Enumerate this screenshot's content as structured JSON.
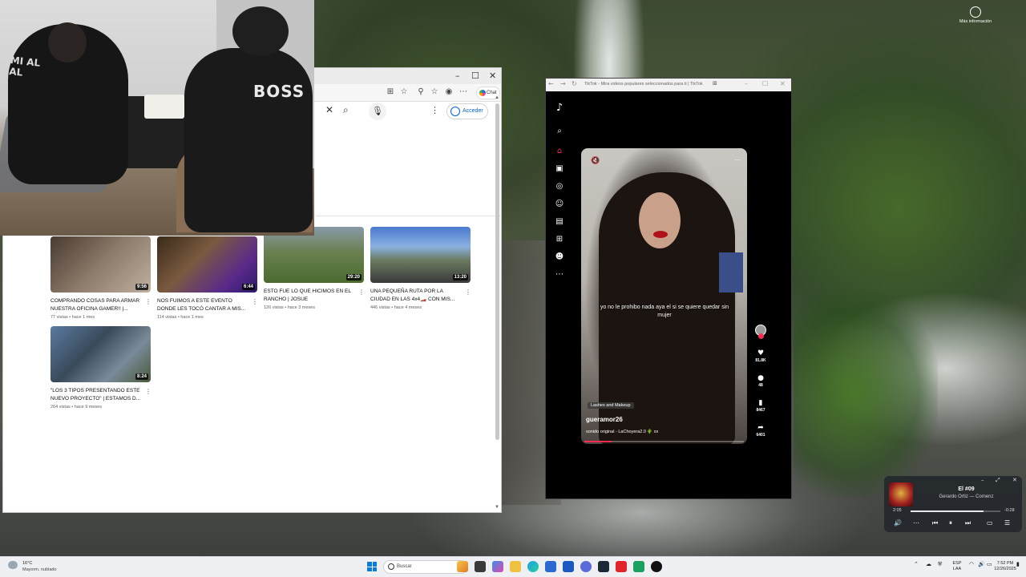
{
  "desktop": {
    "more_info_label": "Más información"
  },
  "browser": {
    "copilot_label": "Chat",
    "signin_label": "Acceder",
    "videos": [
      {
        "title": "COMPRANDO COSAS PARA ARMAR NUESTRA OFICINA GAMER!! |...",
        "meta": "77 vistas • hace 1 mes",
        "duration": "9:56"
      },
      {
        "title": "NOS FUIMOS A ESTE EVENTO DONDE LES TOCÓ CANTAR A MIS...",
        "meta": "114 vistas • hace 1 mes",
        "duration": "6:44"
      },
      {
        "title": "ESTO FUE LO QUE HICIMOS EN EL RANCHO | JOSUE",
        "meta": "126 vistas • hace 3 meses",
        "duration": "29:20"
      },
      {
        "title": "UNA PEQUEÑA RUTA POR LA CIUDAD EN LAS 4x4🏎️ CON MIS...",
        "meta": "446 vistas • hace 4 meses",
        "duration": "13:20"
      },
      {
        "title": "\"LOS 3 TIPOS PRESENTANDO ESTE NUEVO PROYECTO\" | ESTAMOS D...",
        "meta": "264 vistas • hace 9 meses",
        "duration": "8:24"
      }
    ]
  },
  "webcam": {
    "shirt_text": "BOSS",
    "shirt_text_left": "MI AL AL"
  },
  "tiktok": {
    "window_title": "TikTok - Mira videos populares seleccionados para ti | TikTok",
    "caption": "yo no le prohibo nada aya el si se quiere quedar sin mujer",
    "tag": "Lashes and Makeup",
    "username": "gueramor26",
    "sound": "sonido original - LaChoyera2.0 🌵 xx",
    "progress": 0.17,
    "likes": "81.8K",
    "comments": "48",
    "saves": "8467",
    "shares": "6401"
  },
  "player": {
    "title": "El #09",
    "artist": "Gerardo Ortiz — Comenz",
    "elapsed": "2:05",
    "remaining": "-0:28",
    "progress": 0.81
  },
  "taskbar": {
    "temperature": "16°C",
    "weather": "Mayorm. nublado",
    "search_placeholder": "Buscar",
    "lang_top": "ESP",
    "lang_bottom": "LAA",
    "time": "7:52 PM",
    "date": "12/26/2025"
  },
  "colors": {
    "youtube_link": "#065fd4",
    "tiktok_accent": "#fe2c55",
    "windows_blue": "#0a7cd8"
  }
}
